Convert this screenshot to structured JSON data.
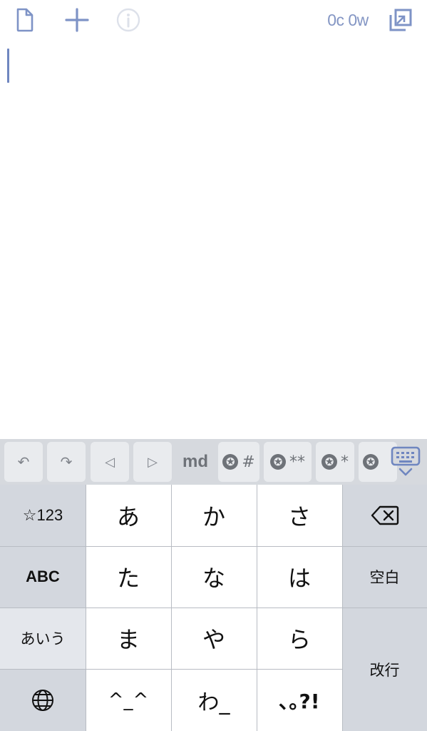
{
  "toolbar": {
    "new_document_icon": "document-icon",
    "add_icon": "plus-icon",
    "info_icon": "info-icon",
    "counter": "0c 0w",
    "expand_icon": "expand-icon",
    "accent_color": "#8496c4"
  },
  "accessory_bar": {
    "keys": [
      "↶",
      "↷",
      "◁",
      "▷",
      "md",
      "#",
      "**",
      "*"
    ],
    "star_glyph": "✪",
    "keyboard_toggle_icon": "keyboard-dismiss-icon"
  },
  "keyboard": {
    "left_column": [
      "☆123",
      "ABC",
      "あいう"
    ],
    "globe_icon": "globe-icon",
    "kana_rows": [
      [
        "あ",
        "か",
        "さ"
      ],
      [
        "た",
        "な",
        "は"
      ],
      [
        "ま",
        "や",
        "ら"
      ],
      [
        "^_^",
        "わ_",
        "､｡?!"
      ]
    ],
    "delete_icon": "backspace-icon",
    "space_label": "空白",
    "return_label": "改行"
  }
}
